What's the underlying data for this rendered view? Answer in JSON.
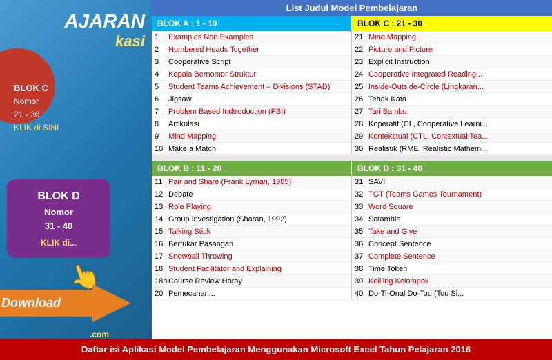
{
  "sidebar": {
    "title1": "AJARAN",
    "title2": "kasi",
    "blok_c_label": "BLOK C",
    "blok_c_sub": "Nomor",
    "blok_c_range": "21 - 30",
    "blok_c_link": "KLIK di SINI",
    "blok_d_label": "BLOK D",
    "blok_d_sub": "Nomor",
    "blok_d_range": "31 - 40",
    "blok_d_link": "KLIK di...",
    "download_text": "Download",
    "dot_com": ".com"
  },
  "list_title": "List Judul Model Pembelajaran",
  "blok_a": {
    "header": "BLOK A : 1 - 10",
    "items": [
      {
        "num": "1",
        "text": "Examples Non Examples"
      },
      {
        "num": "2",
        "text": "Numbered Heads Together"
      },
      {
        "num": "3",
        "text": "Cooperative Script"
      },
      {
        "num": "4",
        "text": "Kepala Bernomor Struktur"
      },
      {
        "num": "5",
        "text": "Student Teams Achievement – Divisions (STAD)"
      },
      {
        "num": "6",
        "text": "Jigsaw"
      },
      {
        "num": "7",
        "text": "Problem Based Indtroduction (PBI)"
      },
      {
        "num": "8",
        "text": "Artikulasi"
      },
      {
        "num": "9",
        "text": "Mind Mapping"
      },
      {
        "num": "10",
        "text": "Make a Match"
      }
    ]
  },
  "blok_c": {
    "header": "BLOK C : 21 - 30",
    "items": [
      {
        "num": "21",
        "text": "Mind Mapping"
      },
      {
        "num": "22",
        "text": "Picture and Picture"
      },
      {
        "num": "23",
        "text": "Explicit Instruction"
      },
      {
        "num": "24",
        "text": "Cooperative Integrated Reading..."
      },
      {
        "num": "25",
        "text": "Inside-Outside-Circle (Lingkaran..."
      },
      {
        "num": "26",
        "text": "Tebak Kata"
      },
      {
        "num": "27",
        "text": "Tari Bambu"
      },
      {
        "num": "28",
        "text": "Koperatif (CL, Cooperative Learni..."
      },
      {
        "num": "29",
        "text": "Kontekstual (CTL, Contextual Tea..."
      },
      {
        "num": "30",
        "text": "Realistik (RME, Realistic Mathem..."
      }
    ]
  },
  "blok_b": {
    "header": "BLOK B : 11 - 20",
    "items": [
      {
        "num": "11",
        "text": "Pair and Share (Frank Lyman, 1985)"
      },
      {
        "num": "12",
        "text": "Debate"
      },
      {
        "num": "13",
        "text": "Role Playing"
      },
      {
        "num": "14",
        "text": "Group Investigation (Sharan, 1992)"
      },
      {
        "num": "15",
        "text": "Talking Stick"
      },
      {
        "num": "16",
        "text": "Bertukar Pasangan"
      },
      {
        "num": "17",
        "text": "Snowball Throwing"
      },
      {
        "num": "18",
        "text": "Student Facilitator and Explaining"
      },
      {
        "num": "18b",
        "text": "Course Review Horay"
      },
      {
        "num": "20",
        "text": "Pemecahan..."
      }
    ]
  },
  "blok_d": {
    "header": "BLOK D : 31 - 40",
    "items": [
      {
        "num": "31",
        "text": "SAVI"
      },
      {
        "num": "32",
        "text": "TGT (Teams Games Tournament)"
      },
      {
        "num": "33",
        "text": "Word Square"
      },
      {
        "num": "34",
        "text": "Scramble"
      },
      {
        "num": "35",
        "text": "Take and Give"
      },
      {
        "num": "36",
        "text": "Concept Sentence"
      },
      {
        "num": "37",
        "text": "Complete Sentence"
      },
      {
        "num": "38",
        "text": "Time Token"
      },
      {
        "num": "39",
        "text": "Keliling Kelompok"
      },
      {
        "num": "40",
        "text": "Do-Ti-Onal Do-Tou (Tou Si..."
      }
    ]
  },
  "footer": "Daftar isi Aplikasi Model Pembelajaran Menggunakan Microsoft Excel Tahun Pelajaran 2016"
}
